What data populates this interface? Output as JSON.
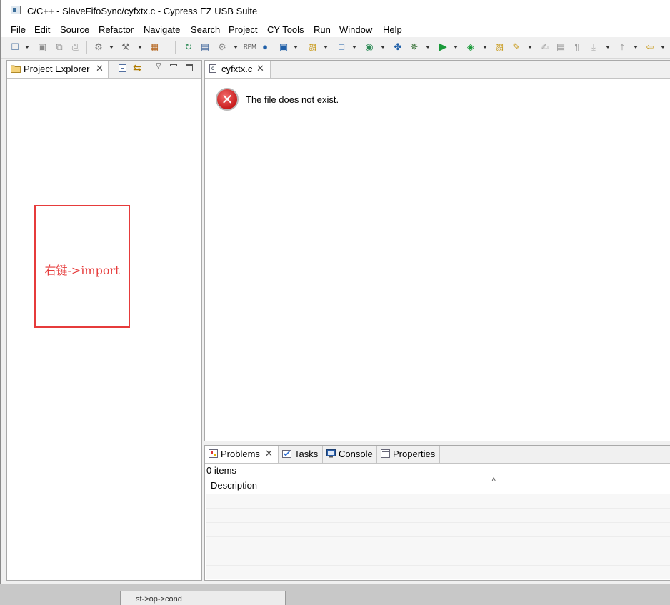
{
  "window": {
    "title": "C/C++ - SlaveFifoSync/cyfxtx.c - Cypress EZ USB Suite"
  },
  "menubar": {
    "items": [
      "File",
      "Edit",
      "Source",
      "Refactor",
      "Navigate",
      "Search",
      "Project",
      "CY Tools",
      "Run",
      "Window",
      "Help"
    ]
  },
  "toolbar": {
    "icons": [
      "new-icon",
      "save-icon",
      "save-all-icon",
      "print-icon",
      "build-config-icon",
      "build-icon",
      "debug-config-icon",
      "refresh-icon",
      "new-class-icon",
      "settings-icon",
      "rpm-icon",
      "browser-icon",
      "new-project-icon",
      "new-folder-icon",
      "new-file-icon",
      "new-target-icon",
      "pin-icon",
      "bug-icon",
      "run-icon",
      "run-external-icon",
      "open-type-icon",
      "open-task-icon",
      "pen-icon",
      "toggle-icon",
      "paragraph-icon",
      "next-annotation-icon",
      "prev-annotation-icon",
      "back-icon"
    ]
  },
  "project_explorer": {
    "tab_label": "Project Explorer",
    "annotation": "右键->import",
    "annotation_color": "#e63b3b"
  },
  "editor": {
    "tab_label": "cyfxtx.c",
    "message": "The file does not exist."
  },
  "problems": {
    "tabs": [
      "Problems",
      "Tasks",
      "Console",
      "Properties"
    ],
    "count": "0 items",
    "column_description": "Description"
  },
  "background": {
    "snippet": "st->op->cond"
  }
}
